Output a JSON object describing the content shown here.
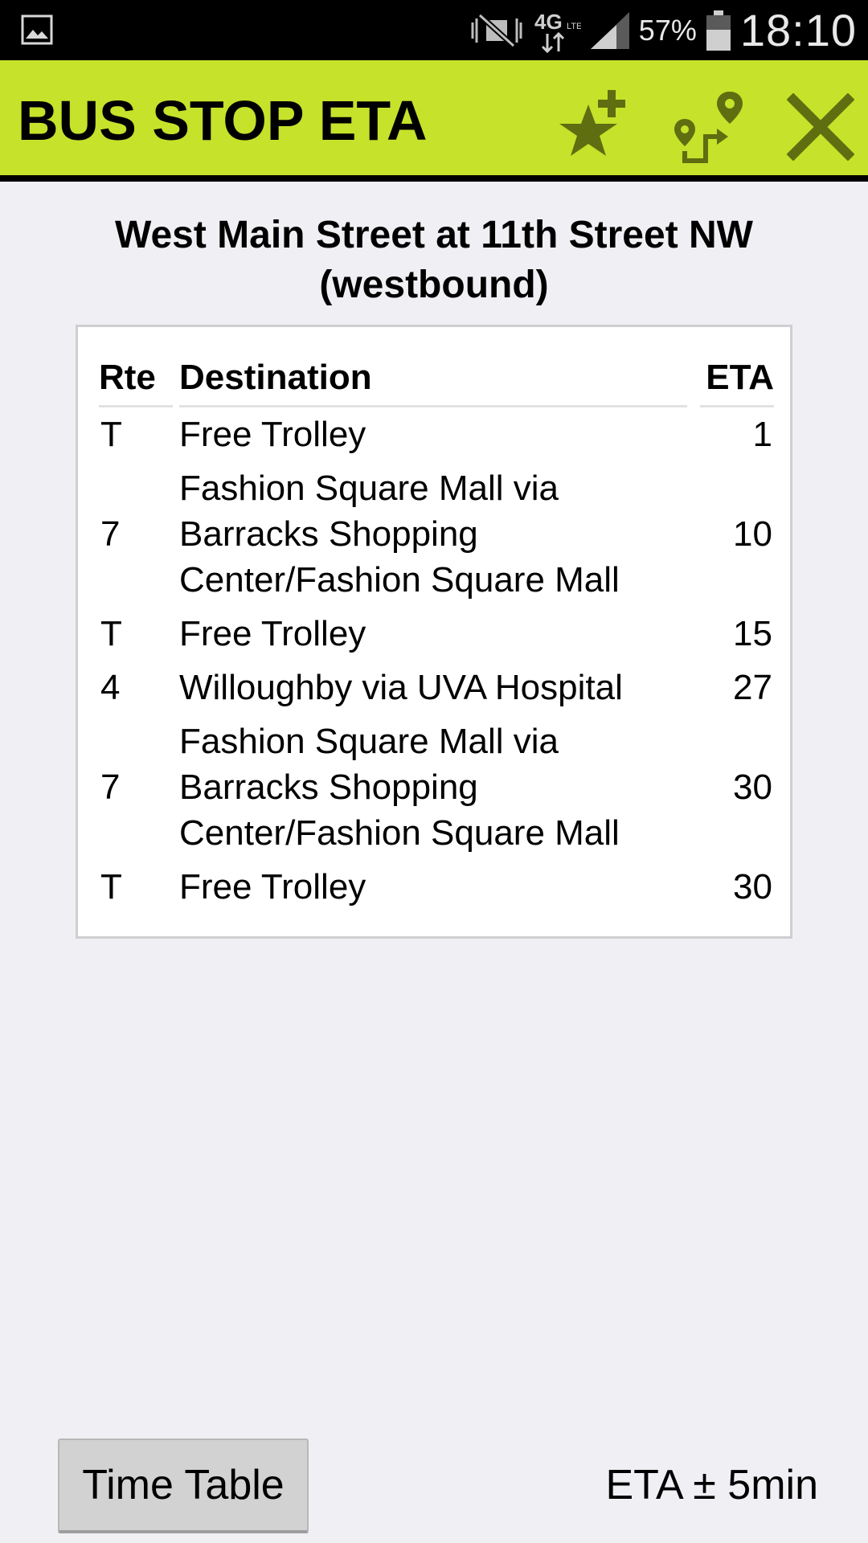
{
  "status_bar": {
    "battery_percent": "57%",
    "time": "18:10",
    "network": "4G LTE",
    "icons": [
      "gallery-icon",
      "mute-icon",
      "lte-icon",
      "signal-icon",
      "battery-icon"
    ]
  },
  "app_bar": {
    "title": "BUS STOP ETA",
    "background_color": "#c6e22a",
    "icon_color": "#5e6e10",
    "actions": [
      "add-favorite-icon",
      "route-map-icon",
      "close-icon"
    ]
  },
  "stop": {
    "name": "West Main Street at 11th Street NW (westbound)"
  },
  "table": {
    "headers": {
      "route": "Rte",
      "destination": "Destination",
      "eta": "ETA"
    },
    "rows": [
      {
        "route": "T",
        "destination": "Free Trolley",
        "eta": "1"
      },
      {
        "route": "7",
        "destination": "Fashion Square Mall via Barracks Shopping Center/Fashion Square Mall",
        "eta": "10"
      },
      {
        "route": "T",
        "destination": "Free Trolley",
        "eta": "15"
      },
      {
        "route": "4",
        "destination": "Willoughby via UVA Hospital",
        "eta": "27"
      },
      {
        "route": "7",
        "destination": "Fashion Square Mall via Barracks Shopping Center/Fashion Square Mall",
        "eta": "30"
      },
      {
        "route": "T",
        "destination": "Free Trolley",
        "eta": "30"
      }
    ]
  },
  "footer": {
    "timetable_label": "Time Table",
    "eta_note": "ETA ± 5min"
  }
}
